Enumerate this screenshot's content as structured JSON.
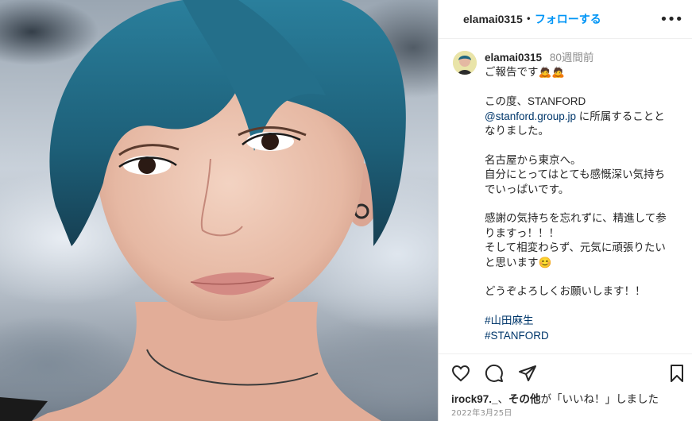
{
  "post": {
    "username": "elamai0315",
    "dot": "•",
    "follow_label": "フォローする",
    "more_label": "•••"
  },
  "caption": {
    "username": "elamai0315",
    "time_ago": "80週間前",
    "line_1": "ご報告です🙇🙇",
    "line_2": "この度、STANFORD",
    "mention": "@stanford.group.jp",
    "line_3_rest": " に所属することと",
    "line_4": "なりました。",
    "line_5": "名古屋から東京へ。",
    "line_6": "自分にとってはとても感慨深い気持ち",
    "line_7": "でいっぱいです。",
    "line_8": "感謝の気持ちを忘れずに、精進して参",
    "line_9": "りますっ！！！",
    "line_10": "そして相変わらず、元気に頑張りたい",
    "line_11": "と思います😊",
    "line_12": "どうぞよろしくお願いします！！",
    "hashtag_1": "#山田麻生",
    "hashtag_2": "#STANFORD"
  },
  "likes": {
    "user": "irock97._",
    "sep": "、",
    "others": "その他",
    "suffix": "が「いいね！」しました"
  },
  "date": "2022年3月25日",
  "icons": [
    "heart-icon",
    "comment-icon",
    "share-icon",
    "save-icon",
    "more-icon"
  ],
  "colors": {
    "accent": "#0095f6",
    "link": "#00376b",
    "muted": "#8e8e8e",
    "hair": "#1f5f78"
  }
}
